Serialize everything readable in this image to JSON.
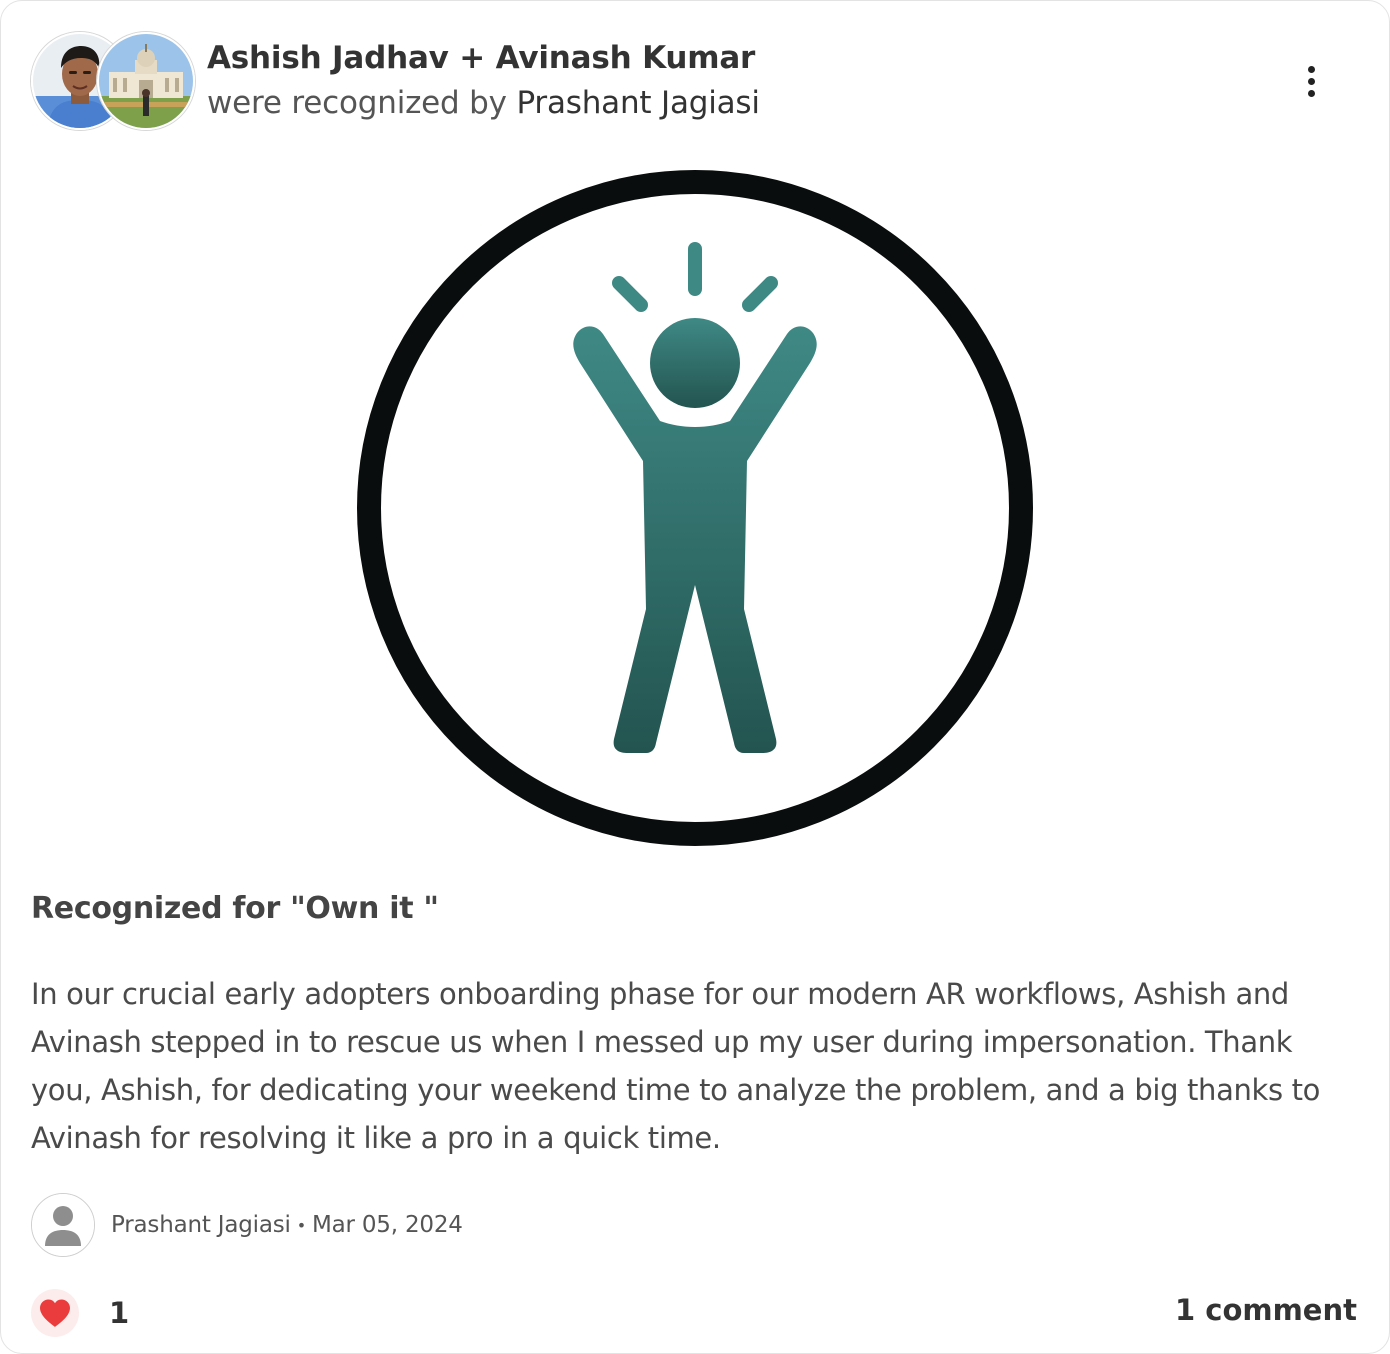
{
  "recognition": {
    "recipients": "Ashish Jadhav + Avinash Kumar",
    "subtitle_prefix": "were recognized by",
    "giver": "Prashant Jagiasi",
    "value_heading": "Recognized for \"Own it \"",
    "message": "In our crucial early adopters onboarding phase for our modern AR workflows, Ashish and Avinash stepped in to rescue us when I messed up my user during impersonation. Thank you, Ashish, for dedicating your weekend time to analyze the problem, and a big thanks to Avinash for resolving it like a pro in a quick time."
  },
  "author": {
    "name": "Prashant Jagiasi",
    "separator": "•",
    "date": "Mar 05, 2024"
  },
  "footer": {
    "like_count": "1",
    "comments_label": "1 comment"
  },
  "icons": {
    "menu": "more-vertical-icon",
    "badge": "celebrating-person-icon",
    "like": "heart-icon",
    "author_avatar": "default-user-icon"
  },
  "colors": {
    "badge_ring": "#0a0d0d",
    "badge_figure_top": "#3f8985",
    "badge_figure_bottom": "#235450",
    "heart": "#ea3c3c",
    "heart_bg": "#fdecec"
  }
}
